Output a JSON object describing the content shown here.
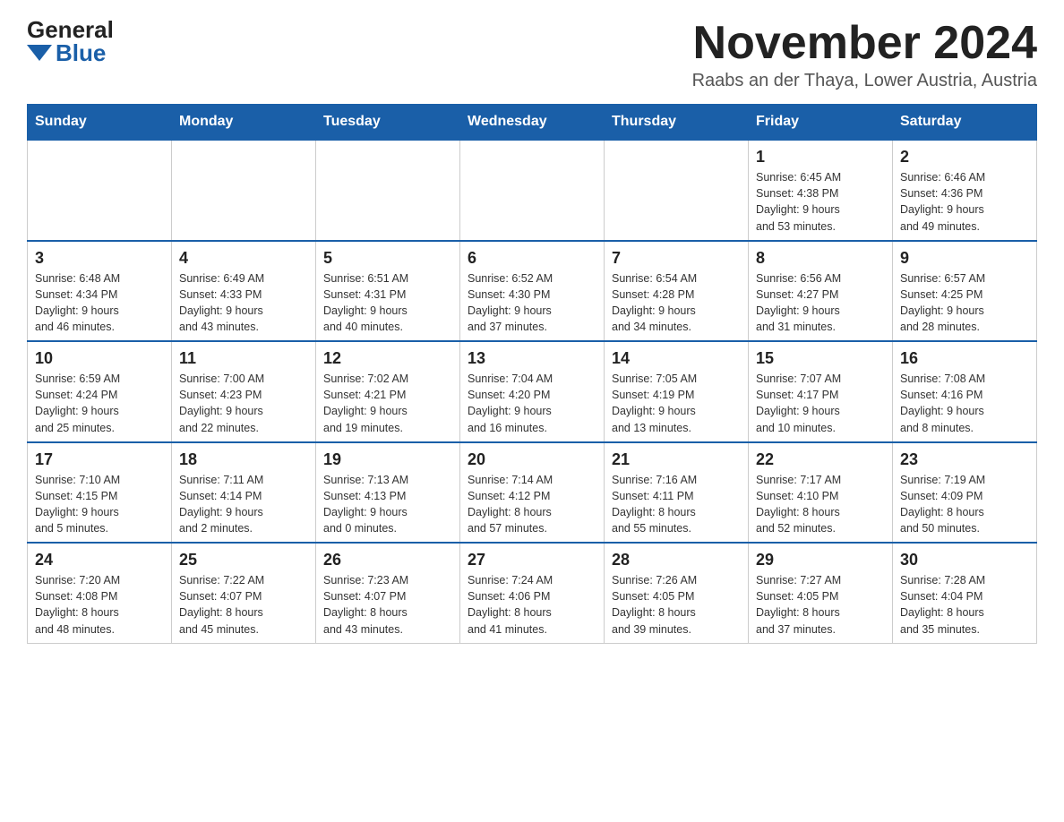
{
  "logo": {
    "general": "General",
    "blue": "Blue"
  },
  "title": "November 2024",
  "location": "Raabs an der Thaya, Lower Austria, Austria",
  "days_of_week": [
    "Sunday",
    "Monday",
    "Tuesday",
    "Wednesday",
    "Thursday",
    "Friday",
    "Saturday"
  ],
  "weeks": [
    [
      {
        "day": "",
        "info": ""
      },
      {
        "day": "",
        "info": ""
      },
      {
        "day": "",
        "info": ""
      },
      {
        "day": "",
        "info": ""
      },
      {
        "day": "",
        "info": ""
      },
      {
        "day": "1",
        "info": "Sunrise: 6:45 AM\nSunset: 4:38 PM\nDaylight: 9 hours\nand 53 minutes."
      },
      {
        "day": "2",
        "info": "Sunrise: 6:46 AM\nSunset: 4:36 PM\nDaylight: 9 hours\nand 49 minutes."
      }
    ],
    [
      {
        "day": "3",
        "info": "Sunrise: 6:48 AM\nSunset: 4:34 PM\nDaylight: 9 hours\nand 46 minutes."
      },
      {
        "day": "4",
        "info": "Sunrise: 6:49 AM\nSunset: 4:33 PM\nDaylight: 9 hours\nand 43 minutes."
      },
      {
        "day": "5",
        "info": "Sunrise: 6:51 AM\nSunset: 4:31 PM\nDaylight: 9 hours\nand 40 minutes."
      },
      {
        "day": "6",
        "info": "Sunrise: 6:52 AM\nSunset: 4:30 PM\nDaylight: 9 hours\nand 37 minutes."
      },
      {
        "day": "7",
        "info": "Sunrise: 6:54 AM\nSunset: 4:28 PM\nDaylight: 9 hours\nand 34 minutes."
      },
      {
        "day": "8",
        "info": "Sunrise: 6:56 AM\nSunset: 4:27 PM\nDaylight: 9 hours\nand 31 minutes."
      },
      {
        "day": "9",
        "info": "Sunrise: 6:57 AM\nSunset: 4:25 PM\nDaylight: 9 hours\nand 28 minutes."
      }
    ],
    [
      {
        "day": "10",
        "info": "Sunrise: 6:59 AM\nSunset: 4:24 PM\nDaylight: 9 hours\nand 25 minutes."
      },
      {
        "day": "11",
        "info": "Sunrise: 7:00 AM\nSunset: 4:23 PM\nDaylight: 9 hours\nand 22 minutes."
      },
      {
        "day": "12",
        "info": "Sunrise: 7:02 AM\nSunset: 4:21 PM\nDaylight: 9 hours\nand 19 minutes."
      },
      {
        "day": "13",
        "info": "Sunrise: 7:04 AM\nSunset: 4:20 PM\nDaylight: 9 hours\nand 16 minutes."
      },
      {
        "day": "14",
        "info": "Sunrise: 7:05 AM\nSunset: 4:19 PM\nDaylight: 9 hours\nand 13 minutes."
      },
      {
        "day": "15",
        "info": "Sunrise: 7:07 AM\nSunset: 4:17 PM\nDaylight: 9 hours\nand 10 minutes."
      },
      {
        "day": "16",
        "info": "Sunrise: 7:08 AM\nSunset: 4:16 PM\nDaylight: 9 hours\nand 8 minutes."
      }
    ],
    [
      {
        "day": "17",
        "info": "Sunrise: 7:10 AM\nSunset: 4:15 PM\nDaylight: 9 hours\nand 5 minutes."
      },
      {
        "day": "18",
        "info": "Sunrise: 7:11 AM\nSunset: 4:14 PM\nDaylight: 9 hours\nand 2 minutes."
      },
      {
        "day": "19",
        "info": "Sunrise: 7:13 AM\nSunset: 4:13 PM\nDaylight: 9 hours\nand 0 minutes."
      },
      {
        "day": "20",
        "info": "Sunrise: 7:14 AM\nSunset: 4:12 PM\nDaylight: 8 hours\nand 57 minutes."
      },
      {
        "day": "21",
        "info": "Sunrise: 7:16 AM\nSunset: 4:11 PM\nDaylight: 8 hours\nand 55 minutes."
      },
      {
        "day": "22",
        "info": "Sunrise: 7:17 AM\nSunset: 4:10 PM\nDaylight: 8 hours\nand 52 minutes."
      },
      {
        "day": "23",
        "info": "Sunrise: 7:19 AM\nSunset: 4:09 PM\nDaylight: 8 hours\nand 50 minutes."
      }
    ],
    [
      {
        "day": "24",
        "info": "Sunrise: 7:20 AM\nSunset: 4:08 PM\nDaylight: 8 hours\nand 48 minutes."
      },
      {
        "day": "25",
        "info": "Sunrise: 7:22 AM\nSunset: 4:07 PM\nDaylight: 8 hours\nand 45 minutes."
      },
      {
        "day": "26",
        "info": "Sunrise: 7:23 AM\nSunset: 4:07 PM\nDaylight: 8 hours\nand 43 minutes."
      },
      {
        "day": "27",
        "info": "Sunrise: 7:24 AM\nSunset: 4:06 PM\nDaylight: 8 hours\nand 41 minutes."
      },
      {
        "day": "28",
        "info": "Sunrise: 7:26 AM\nSunset: 4:05 PM\nDaylight: 8 hours\nand 39 minutes."
      },
      {
        "day": "29",
        "info": "Sunrise: 7:27 AM\nSunset: 4:05 PM\nDaylight: 8 hours\nand 37 minutes."
      },
      {
        "day": "30",
        "info": "Sunrise: 7:28 AM\nSunset: 4:04 PM\nDaylight: 8 hours\nand 35 minutes."
      }
    ]
  ]
}
